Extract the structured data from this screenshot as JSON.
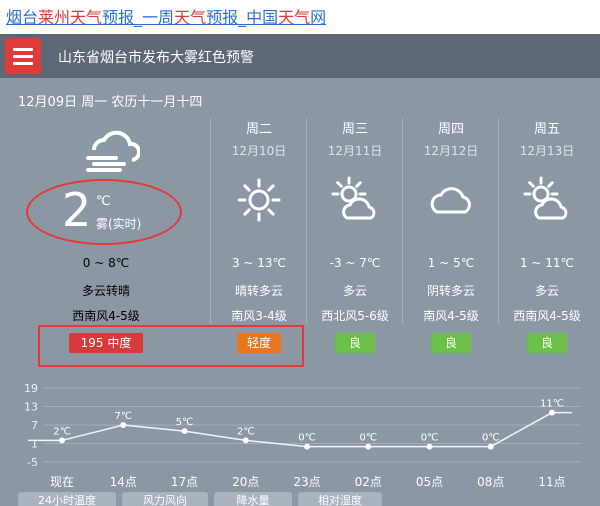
{
  "title_link": {
    "parts": [
      {
        "text": "烟台",
        "hl": false
      },
      {
        "text": "莱州",
        "hl": true
      },
      {
        "text": "天气",
        "hl": true
      },
      {
        "text": "预报_一周",
        "hl": false
      },
      {
        "text": "天气",
        "hl": true
      },
      {
        "text": "预报_中国",
        "hl": false
      },
      {
        "text": "天气",
        "hl": true
      },
      {
        "text": "网",
        "hl": false
      }
    ]
  },
  "header": {
    "alert": "山东省烟台市发布大雾红色预警",
    "menu_icon": "hamburger-icon"
  },
  "today": {
    "date": "12月09日 周一 农历十一月十四",
    "icon": "cloud-fog-icon",
    "temp": "2",
    "unit": "℃",
    "desc": "雾(实时)",
    "range": "0 ~ 8℃",
    "cond": "多云转晴",
    "wind": "西南风4-5级",
    "aqi": "195  中度",
    "aqi_color": "#d73a3a"
  },
  "forecast": [
    {
      "day": "周二",
      "date": "12月10日",
      "icon": "sun-icon",
      "temp": "3 ~ 13℃",
      "cond": "晴转多云",
      "wind": "南风3-4级",
      "aqi": "轻度",
      "aqi_color": "#e8761e"
    },
    {
      "day": "周三",
      "date": "12月11日",
      "icon": "partly-cloudy-icon",
      "temp": "-3 ~ 7℃",
      "cond": "多云",
      "wind": "西北风5-6级",
      "aqi": "良",
      "aqi_color": "#6cc04a"
    },
    {
      "day": "周四",
      "date": "12月12日",
      "icon": "cloud-icon",
      "temp": "1 ~ 5℃",
      "cond": "阴转多云",
      "wind": "南风4-5级",
      "aqi": "良",
      "aqi_color": "#6cc04a"
    },
    {
      "day": "周五",
      "date": "12月13日",
      "icon": "partly-cloudy-icon",
      "temp": "1 ~ 11℃",
      "cond": "多云",
      "wind": "西南风4-5级",
      "aqi": "良",
      "aqi_color": "#6cc04a"
    }
  ],
  "chart_data": {
    "type": "line",
    "x": [
      "现在",
      "14点",
      "17点",
      "20点",
      "23点",
      "02点",
      "05点",
      "08点",
      "11点"
    ],
    "values": [
      2,
      7,
      5,
      2,
      0,
      0,
      0,
      0,
      11
    ],
    "point_labels": [
      "2℃",
      "7℃",
      "5℃",
      "2℃",
      "0℃",
      "0℃",
      "0℃",
      "0℃",
      "11℃"
    ],
    "yticks": [
      "19",
      "13",
      "7",
      "1",
      "-5"
    ],
    "ylim": [
      -5,
      19
    ],
    "grid": true
  },
  "tabs": [
    "24小时温度",
    "风力风向",
    "降水量",
    "相对湿度"
  ]
}
